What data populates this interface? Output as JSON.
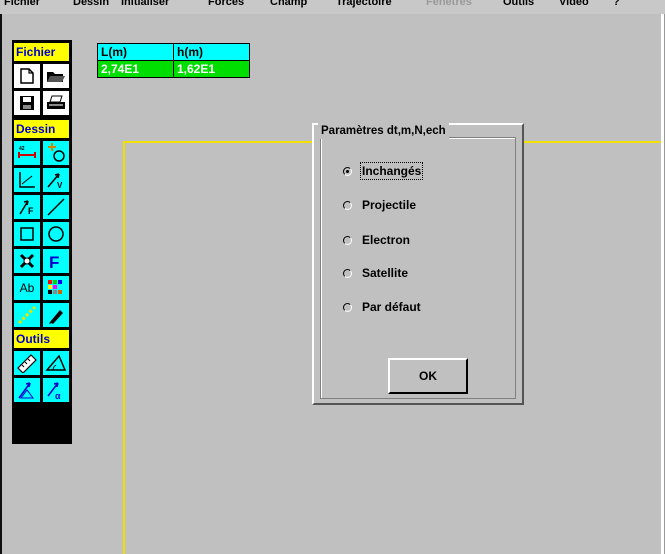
{
  "menu": [
    "Fichier",
    "Dessin",
    "Initialiser",
    "Forces",
    "Champ",
    "Trajectoire",
    "Fenêtres",
    "Outils",
    "Vidéo",
    "?"
  ],
  "toolbar": {
    "fichier_label": "Fichier",
    "dessin_label": "Dessin",
    "outils_label": "Outils",
    "text_tool_label": "Ab"
  },
  "readout": {
    "l_head": "L(m)",
    "h_head": "h(m)",
    "l_val": "2,74E1",
    "h_val": "1,62E1"
  },
  "dialog": {
    "title": "Paramètres dt,m,N,ech",
    "options": [
      "Inchangés",
      "Projectile",
      "Electron",
      "Satellite",
      "Par défaut"
    ],
    "selected": "Inchangés",
    "ok_label": "OK"
  },
  "colors": {
    "background": "#c0c0c0",
    "toolbar_head": "#ffff00",
    "tool_button": "#00ffff",
    "value_cell": "#00dd00",
    "draw_frame": "#f2e000"
  }
}
